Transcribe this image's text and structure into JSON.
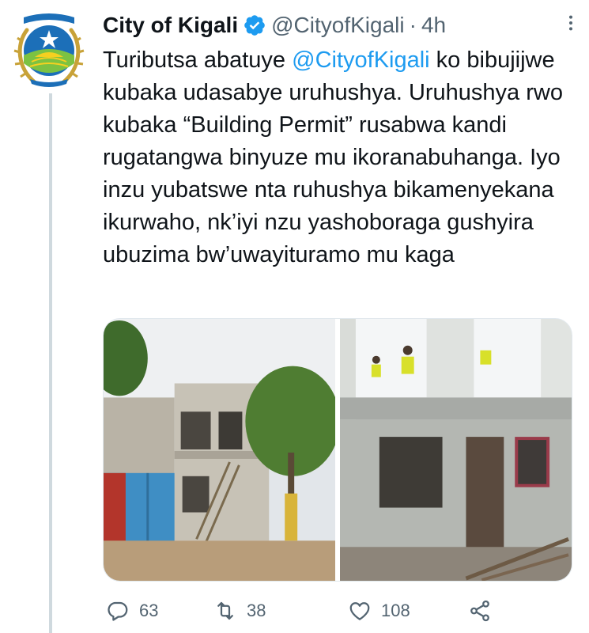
{
  "author": {
    "display_name": "City of Kigali",
    "handle": "@CityofKigali",
    "separator": "·",
    "time": "4h",
    "avatar_text": "UMUJYI WA KIGALI",
    "avatar_motto": "Kigali ikwiye kubaho",
    "verified_color": "#1d9bf0"
  },
  "tweet": {
    "text_before": "Tuributsa abatuye ",
    "mention": "@CityofKigali",
    "text_after": " ko bibujijwe kubaka udasabye uruhushya. Uruhushya rwo kubaka “Building Permit” rusabwa kandi rugatangwa binyuze mu ikoranabuhanga. Iyo inzu yubatswe nta ruhushya bikamenyekana ikurwaho, nk’iyi nzu yashoboraga gushyira ubuzima bw’uwayituramo mu kaga"
  },
  "media": {
    "photos": [
      {
        "subject": "two-storey unfinished house with blue gate and ladder"
      },
      {
        "subject": "workers in yellow vests demolishing house walls"
      }
    ]
  },
  "actions": {
    "reply_count": "63",
    "retweet_count": "38",
    "like_count": "108"
  },
  "colors": {
    "text": "#0f1419",
    "secondary": "#536471",
    "link": "#1d9bf0",
    "thread_line": "#cfd9de"
  }
}
